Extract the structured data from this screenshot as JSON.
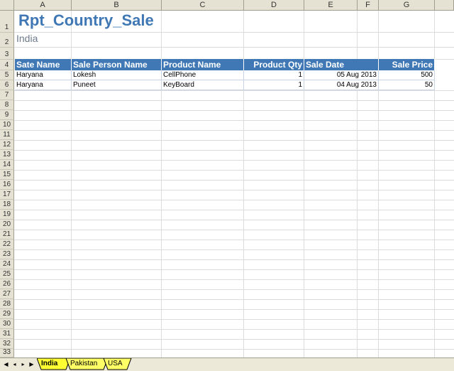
{
  "columns": [
    "A",
    "B",
    "C",
    "D",
    "E",
    "F",
    "G"
  ],
  "rows": [
    "1",
    "2",
    "3",
    "4",
    "5",
    "6",
    "7",
    "8",
    "9",
    "10",
    "11",
    "12",
    "13",
    "14",
    "15",
    "16",
    "17",
    "18",
    "19",
    "20",
    "21",
    "22",
    "23",
    "24",
    "25",
    "26",
    "27",
    "28",
    "29",
    "30",
    "31",
    "32",
    "33"
  ],
  "report": {
    "title": "Rpt_Country_Sale",
    "subtitle": "India"
  },
  "table": {
    "headers": [
      "Sate Name",
      "Sale Person Name",
      "Product Name",
      "Product Qty",
      "Sale Date",
      "Sale Price"
    ],
    "rows": [
      [
        "Haryana",
        "Lokesh",
        "CellPhone",
        "1",
        "05 Aug 2013",
        "500"
      ],
      [
        "Haryana",
        "Puneet",
        "KeyBoard",
        "1",
        "04 Aug 2013",
        "50"
      ]
    ]
  },
  "sheet_tabs": {
    "tabs": [
      "India",
      "Pakistan",
      "USA"
    ],
    "active": "India",
    "highlight_color": "#ffff33"
  },
  "colors": {
    "header_fill": "#3f78b5",
    "title_color": "#3f78b5"
  }
}
